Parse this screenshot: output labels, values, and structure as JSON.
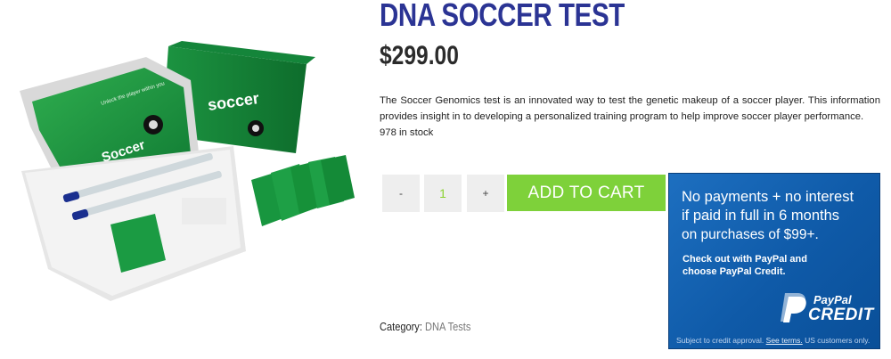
{
  "product": {
    "title": "DNA SOCCER TEST",
    "price": "$299.00",
    "description": "The Soccer Genomics test is an innovated way to test the genetic makeup of a soccer player. This information provides insight in to developing a personalized training program to help improve soccer player performance.",
    "stock": "978 in stock",
    "image": {
      "box_title": "Soccer",
      "box_tagline": "Unlock the player within you",
      "icon": "product-kit-photo"
    }
  },
  "cart": {
    "minus_label": "-",
    "quantity": "1",
    "plus_label": "+",
    "add_label": "ADD TO CART",
    "accent_color": "#7ed13a"
  },
  "category": {
    "label": "Category:",
    "value": "DNA Tests"
  },
  "paypal_banner": {
    "line1": "No payments + no interest",
    "line2": "if paid in full in 6 months",
    "line3": "on purchases of $99+.",
    "sub1": "Check out with PayPal and",
    "sub2": "choose PayPal Credit.",
    "brand": "PayPal",
    "credit": "CREDIT",
    "footer_pre": "Subject to credit approval.",
    "footer_link": "See terms.",
    "footer_post": "US customers only.",
    "bg_color": "#1d6fc0"
  },
  "colors": {
    "title": "#2b3494",
    "price": "#2b2b2b"
  }
}
